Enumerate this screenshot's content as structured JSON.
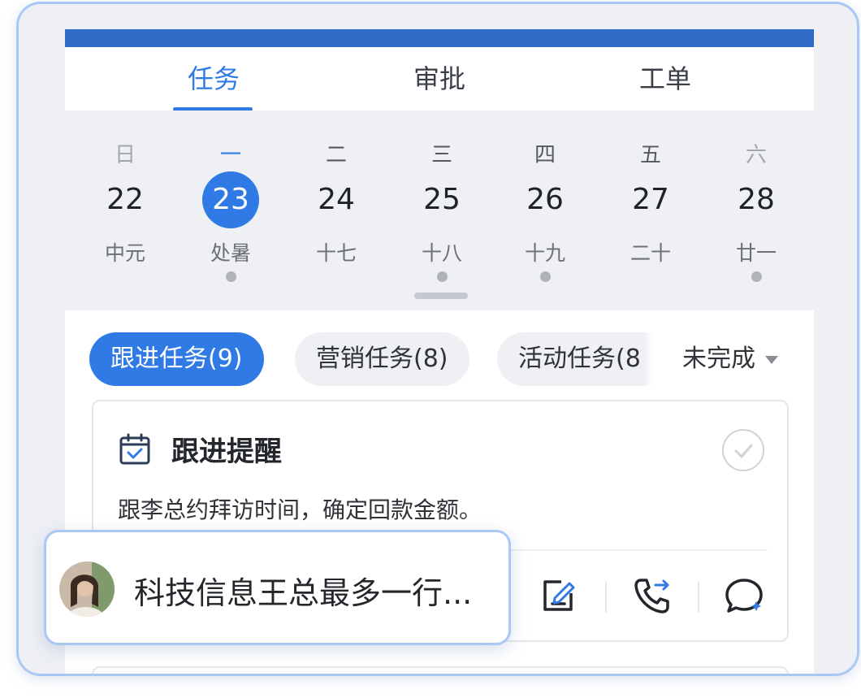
{
  "tabs": [
    {
      "label": "任务",
      "active": true
    },
    {
      "label": "审批",
      "active": false
    },
    {
      "label": "工单",
      "active": false
    }
  ],
  "calendar": {
    "days": [
      {
        "dow": "日",
        "date": "22",
        "lunar": "中元",
        "has_event": false
      },
      {
        "dow": "一",
        "date": "23",
        "lunar": "处暑",
        "has_event": true,
        "selected": true
      },
      {
        "dow": "二",
        "date": "24",
        "lunar": "十七",
        "has_event": false
      },
      {
        "dow": "三",
        "date": "25",
        "lunar": "十八",
        "has_event": true
      },
      {
        "dow": "四",
        "date": "26",
        "lunar": "十九",
        "has_event": true
      },
      {
        "dow": "五",
        "date": "27",
        "lunar": "二十",
        "has_event": false
      },
      {
        "dow": "六",
        "date": "28",
        "lunar": "廿一",
        "has_event": true
      }
    ]
  },
  "filters": {
    "chips": [
      {
        "label": "跟进任务(9)",
        "active": true
      },
      {
        "label": "营销任务(8)",
        "active": false
      },
      {
        "label": "活动任务(8",
        "active": false
      }
    ],
    "status": "未完成"
  },
  "card": {
    "icon": "calendar-check-icon",
    "title": "跟进提醒",
    "text": "跟李总约拜访时间，确定回款金额。",
    "actions": [
      "edit-icon",
      "phone-forward-icon",
      "chat-ai-icon"
    ]
  },
  "popup": {
    "text": "科技信息王总最多一行..."
  },
  "colors": {
    "accent": "#2f7ae5",
    "topbar": "#2f6bc7",
    "popup_border": "#a9c8f5"
  }
}
